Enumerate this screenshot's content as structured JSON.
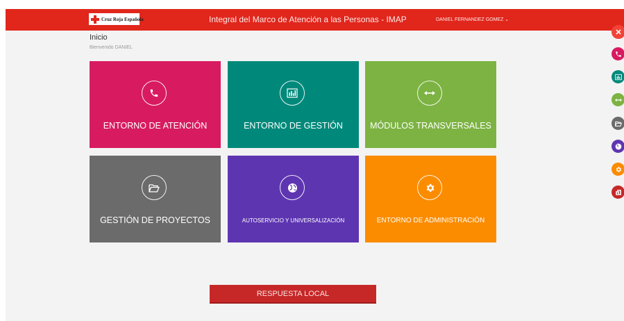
{
  "header": {
    "logo_text": "Cruz Roja Española",
    "title": "Integral del Marco de Atención a las Personas - IMAP",
    "user": "DANIEL FERNANDEZ GOMEZ ⌄",
    "brand_color": "#e1261c"
  },
  "page": {
    "title": "Inicio",
    "welcome": "Bienvenido DANIEL"
  },
  "tiles": [
    {
      "label": "ENTORNO DE ATENCIÓN",
      "icon": "phone-icon",
      "color": "#d81b60"
    },
    {
      "label": "ENTORNO DE GESTIÓN",
      "icon": "bar-chart-icon",
      "color": "#00897b"
    },
    {
      "label": "MÓDULOS TRANSVERSALES",
      "icon": "arrows-horizontal-icon",
      "color": "#7cb342"
    },
    {
      "label": "GESTIÓN DE PROYECTOS",
      "icon": "folder-open-icon",
      "color": "#6b6b6b"
    },
    {
      "label": "AUTOSERVICIO Y UNIVERSALIZACIÓN",
      "icon": "globe-icon",
      "color": "#5e35b1"
    },
    {
      "label": "ENTORNO DE ADMINISTRACIÓN",
      "icon": "gear-icon",
      "color": "#fb8c00"
    }
  ],
  "local_button": {
    "label": "RESPUESTA LOCAL",
    "color": "#c62828"
  },
  "quick_actions": {
    "close_icon": "close-icon",
    "items": [
      "phone-icon",
      "bar-chart-icon",
      "arrows-horizontal-icon",
      "folder-open-icon",
      "globe-icon",
      "gear-icon",
      "local-response-icon"
    ]
  }
}
